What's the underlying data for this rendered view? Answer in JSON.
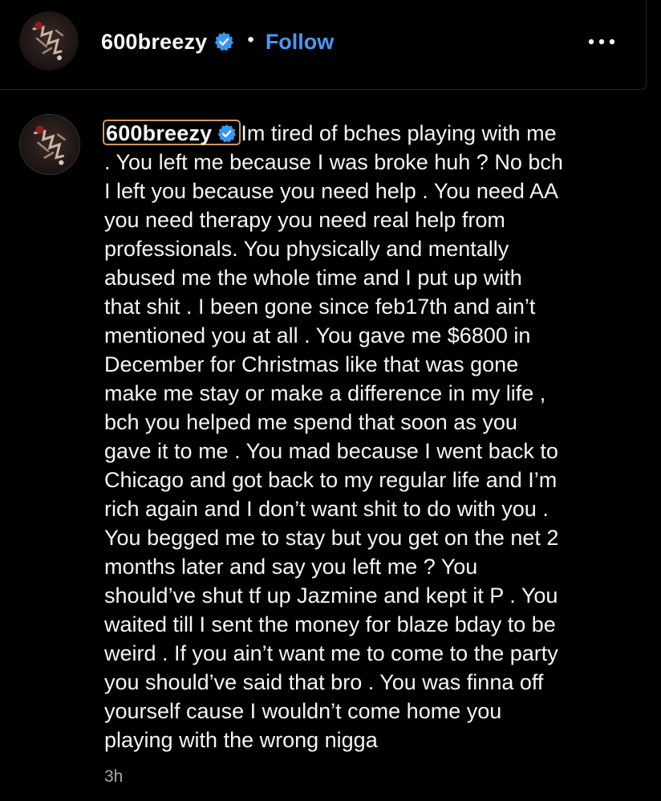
{
  "header": {
    "username": "600breezy",
    "separator": "•",
    "follow_label": "Follow",
    "verified_icon": "verified-badge-icon",
    "more_icon": "more-options-icon"
  },
  "post": {
    "username": "600breezy",
    "caption": "Im tired of bches playing with me\n. You left me because I was broke huh ? No bch\nI left you because you need help . You need AA\nyou need therapy you need real help from\nprofessionals. You physically and mentally\nabused me the whole time and I put up with\nthat shit . I been gone since feb17th and ain’t\nmentioned you at all . You gave me $6800 in\nDecember for Christmas like that was gone\nmake me stay or make a difference in my life ,\nbch you helped me spend that soon as you\ngave it to me . You mad because I went back to\nChicago and got back to my regular life and I’m\nrich again and I don’t want shit to do with you .\nYou begged me to stay but you get on the net 2\nmonths later and say you left me ? You\nshould’ve shut tf up Jazmine and kept it P . You\nwaited till I sent the money for blaze bday to be\nweird . If you ain’t want me to come to the party\nyou should’ve said that bro . You was finna off\nyourself cause I wouldn’t come home you\nplaying with the wrong nigga",
    "timestamp": "3h"
  },
  "colors": {
    "background": "#000000",
    "text": "#f5f5f5",
    "follow": "#4a97f5",
    "verified": "#3897f0",
    "muted": "#a8a8a8",
    "divider": "#262626",
    "highlight_border": "#c99a68"
  }
}
